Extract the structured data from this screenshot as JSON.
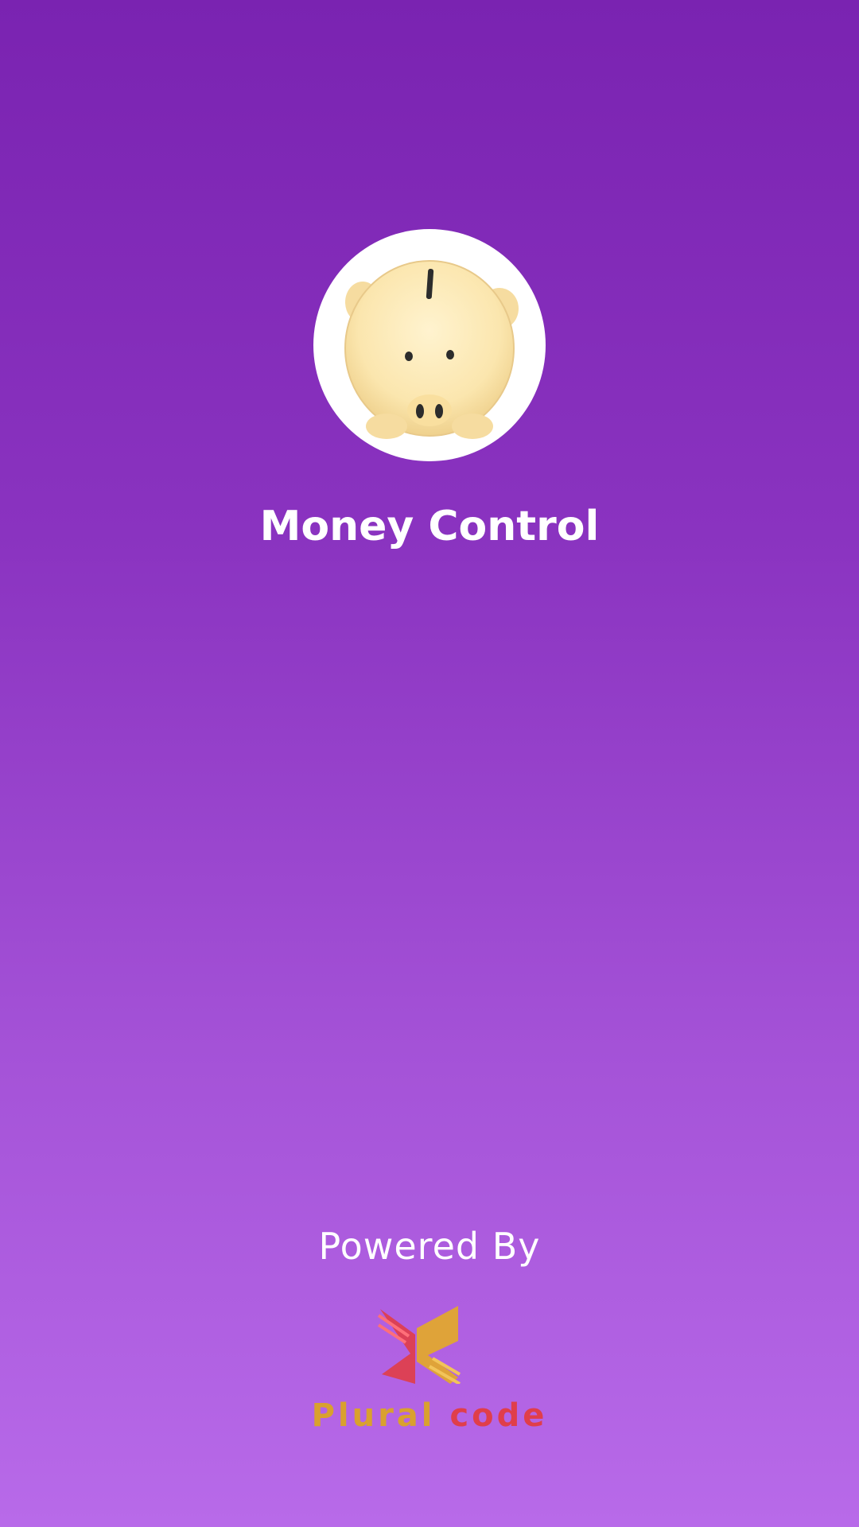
{
  "app": {
    "title": "Money Control",
    "logo_icon": "piggy-bank-icon"
  },
  "footer": {
    "powered_by": "Powered By",
    "brand_icon": "plural-code-logo-icon",
    "brand_name_part1": "Plural",
    "brand_name_part2": "code"
  },
  "colors": {
    "background_top": "#7a23b1",
    "background_bottom": "#b86ae9",
    "piggy": "#fbe6ae",
    "brand_yellow": "#d9a12e",
    "brand_red": "#e03e4a"
  }
}
